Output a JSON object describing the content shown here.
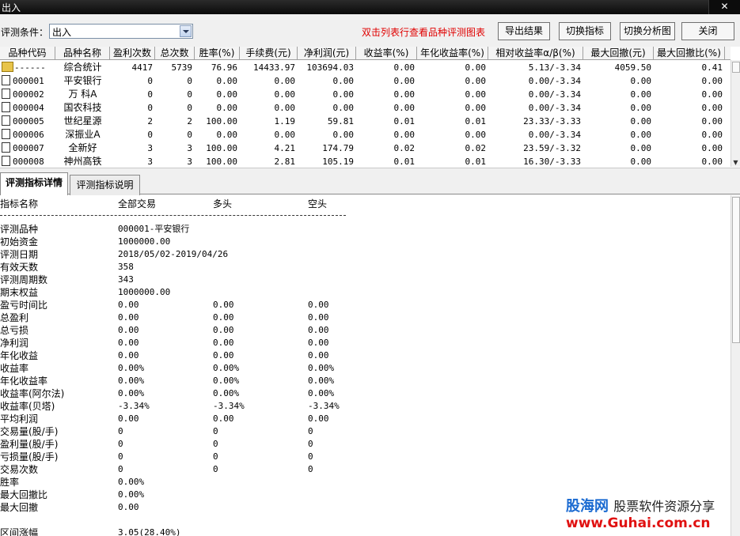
{
  "window": {
    "title": "出入",
    "close": "✕"
  },
  "toolbar": {
    "condition_label": "评测条件：",
    "condition_value": "出入",
    "hint": "双击列表行查看品种评测图表",
    "buttons": [
      "导出结果",
      "切换指标",
      "切换分析图",
      "关闭"
    ]
  },
  "grid": {
    "columns": [
      "品种代码",
      "品种名称",
      "盈利次数",
      "总次数",
      "胜率(%)",
      "手续费(元)",
      "净利润(元)",
      "收益率(%)",
      "年化收益率(%)",
      "相对收益率α/β(%)",
      "最大回撤(元)",
      "最大回撤比(%)"
    ],
    "rows": [
      [
        "------",
        "综合统计",
        "4417",
        "5739",
        "76.96",
        "14433.97",
        "103694.03",
        "0.00",
        "0.00",
        "5.13/-3.34",
        "4059.50",
        "0.41"
      ],
      [
        "000001",
        "平安银行",
        "0",
        "0",
        "0.00",
        "0.00",
        "0.00",
        "0.00",
        "0.00",
        "0.00/-3.34",
        "0.00",
        "0.00"
      ],
      [
        "000002",
        "万 科A",
        "0",
        "0",
        "0.00",
        "0.00",
        "0.00",
        "0.00",
        "0.00",
        "0.00/-3.34",
        "0.00",
        "0.00"
      ],
      [
        "000004",
        "国农科技",
        "0",
        "0",
        "0.00",
        "0.00",
        "0.00",
        "0.00",
        "0.00",
        "0.00/-3.34",
        "0.00",
        "0.00"
      ],
      [
        "000005",
        "世纪星源",
        "2",
        "2",
        "100.00",
        "1.19",
        "59.81",
        "0.01",
        "0.01",
        "23.33/-3.33",
        "0.00",
        "0.00"
      ],
      [
        "000006",
        "深振业A",
        "0",
        "0",
        "0.00",
        "0.00",
        "0.00",
        "0.00",
        "0.00",
        "0.00/-3.34",
        "0.00",
        "0.00"
      ],
      [
        "000007",
        "全新好",
        "3",
        "3",
        "100.00",
        "4.21",
        "174.79",
        "0.02",
        "0.02",
        "23.59/-3.32",
        "0.00",
        "0.00"
      ],
      [
        "000008",
        "神州高铁",
        "3",
        "3",
        "100.00",
        "2.81",
        "105.19",
        "0.01",
        "0.01",
        "16.30/-3.33",
        "0.00",
        "0.00"
      ]
    ]
  },
  "tabs": [
    "评测指标详情",
    "评测指标说明"
  ],
  "detail": {
    "headers": [
      "指标名称",
      "全部交易",
      "多头",
      "空头"
    ],
    "rows": [
      [
        "评测品种",
        "000001-平安银行",
        "",
        ""
      ],
      [
        "初始资金",
        "1000000.00",
        "",
        ""
      ],
      [
        "评测日期",
        "2018/05/02-2019/04/26",
        "",
        ""
      ],
      [
        "有效天数",
        "358",
        "",
        ""
      ],
      [
        "评测周期数",
        "343",
        "",
        ""
      ],
      [
        "期末权益",
        "1000000.00",
        "",
        ""
      ],
      [
        "盈亏时间比",
        "0.00",
        "0.00",
        "0.00"
      ],
      [
        "总盈利",
        "0.00",
        "0.00",
        "0.00"
      ],
      [
        "总亏损",
        "0.00",
        "0.00",
        "0.00"
      ],
      [
        "净利润",
        "0.00",
        "0.00",
        "0.00"
      ],
      [
        "年化收益",
        "0.00",
        "0.00",
        "0.00"
      ],
      [
        "收益率",
        "0.00%",
        "0.00%",
        "0.00%"
      ],
      [
        "年化收益率",
        "0.00%",
        "0.00%",
        "0.00%"
      ],
      [
        "收益率(阿尔法)",
        "0.00%",
        "0.00%",
        "0.00%"
      ],
      [
        "收益率(贝塔)",
        "-3.34%",
        "-3.34%",
        "-3.34%"
      ],
      [
        "平均利润",
        "0.00",
        "0.00",
        "0.00"
      ],
      [
        "交易量(股/手)",
        "0",
        "0",
        "0"
      ],
      [
        "盈利量(股/手)",
        "0",
        "0",
        "0"
      ],
      [
        "亏损量(股/手)",
        "0",
        "0",
        "0"
      ],
      [
        "交易次数",
        "0",
        "0",
        "0"
      ],
      [
        "胜率",
        "0.00%",
        "",
        ""
      ],
      [
        "最大回撤比",
        "0.00%",
        "",
        ""
      ],
      [
        "最大回撤",
        "0.00",
        "",
        ""
      ],
      [
        "",
        "",
        "",
        ""
      ],
      [
        "区间涨幅",
        "3.05(28.40%)",
        "",
        ""
      ]
    ]
  },
  "watermark": {
    "line1_a": "股海网",
    "line1_b": "股票软件资源分享",
    "line2": "www.Guhai.com.cn"
  }
}
